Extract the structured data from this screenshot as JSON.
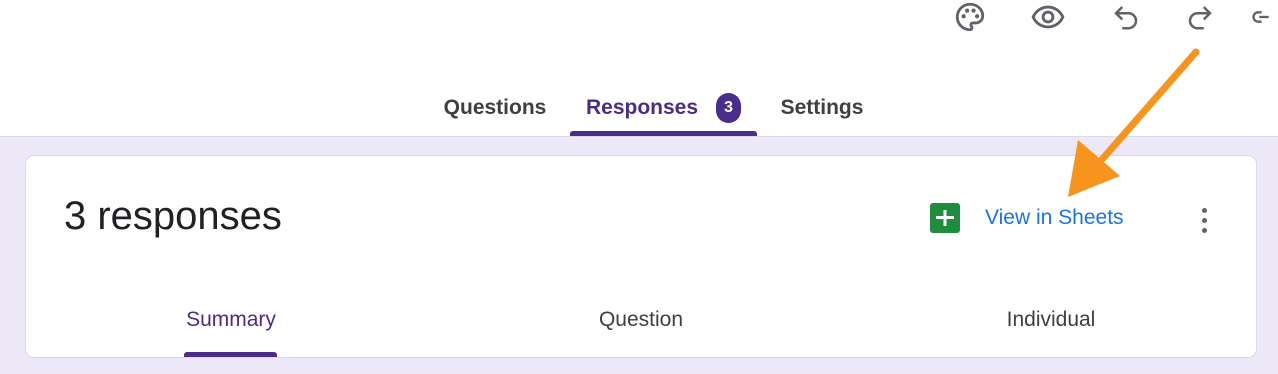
{
  "toolbar": {
    "icons": [
      "palette-icon",
      "eye-icon",
      "undo-icon",
      "redo-icon",
      "link-icon"
    ]
  },
  "tabs": {
    "questions": "Questions",
    "responses": "Responses",
    "responses_badge": "3",
    "settings": "Settings",
    "active": "responses"
  },
  "card": {
    "title": "3 responses",
    "sheets_link": "View in Sheets"
  },
  "sub_tabs": {
    "summary": "Summary",
    "question": "Question",
    "individual": "Individual",
    "active": "summary"
  },
  "colors": {
    "accent": "#4a2d8b",
    "link": "#1a73e8",
    "sheets_green": "#1e8e3e",
    "annotation_arrow": "#f7941d",
    "background": "#ede8f7"
  }
}
